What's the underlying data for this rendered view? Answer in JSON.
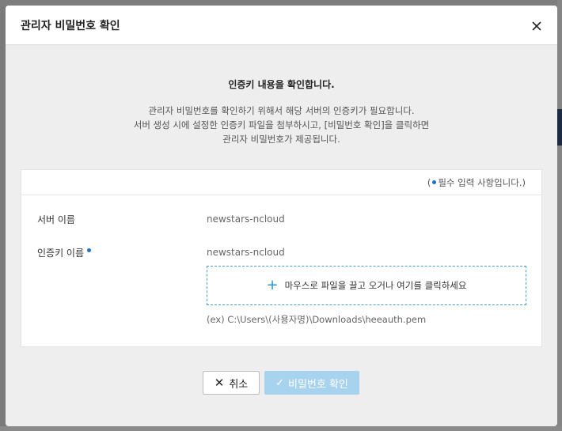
{
  "dialog": {
    "title": "관리자 비밀번호 확인",
    "close_icon": "close-icon"
  },
  "intro": {
    "heading": "인증키 내용을 확인합니다.",
    "lines": [
      "관리자 비밀번호를 확인하기 위해서 해당 서버의 인증키가 필요합니다.",
      "서버 생성 시에 설정한 인증키 파일을 첨부하시고, [비밀번호 확인]을 클릭하면",
      "관리자 비밀번호가 제공됩니다."
    ]
  },
  "form": {
    "required_note_open": "(",
    "required_note_text": "필수 입력 사항입니다.)",
    "server_name_label": "서버 이름",
    "server_name_value": "newstars-ncloud",
    "key_name_label": "인증키 이름",
    "key_name_value": "newstars-ncloud",
    "dropzone_text": "마우스로 파일을 끌고 오거나 여기를 클릭하세요",
    "path_example": "(ex) C:\\Users\\(사용자명)\\Downloads\\heeauth.pem"
  },
  "buttons": {
    "cancel_label": "취소",
    "confirm_label": "비밀번호 확인"
  },
  "colors": {
    "accent": "#2f8fd8",
    "required_dot": "#1a73c8",
    "confirm_disabled": "#a8d3ee"
  }
}
